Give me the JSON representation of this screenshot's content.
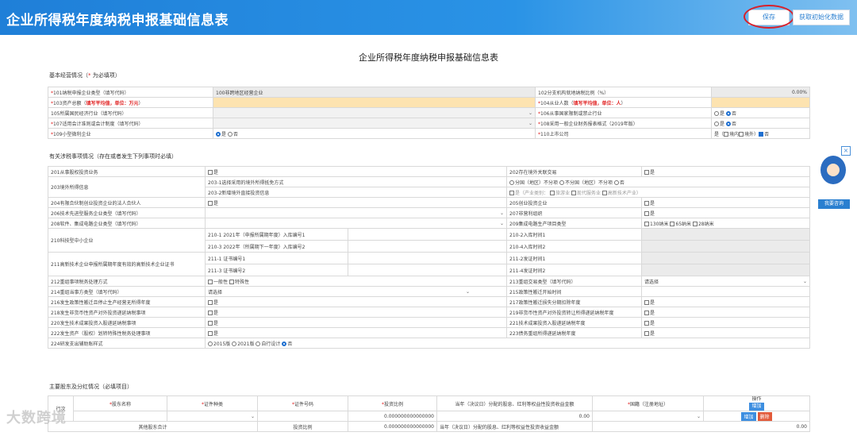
{
  "header": {
    "title": "企业所得税年度纳税申报基础信息表",
    "save_label": "保存",
    "fetch_label": "获取初始化数据"
  },
  "page_title": "企业所得税年度纳税申报基础信息表",
  "basic": {
    "heading": "基本经营情况（",
    "heading_star": "*",
    "heading_tail": " 为必填项）",
    "r101": "101纳税申报企业类型（填写代码）",
    "v101": "100非跨地区经营企业",
    "r102": "102分支机构就地纳税比例（%）",
    "v102": "0.00%",
    "r103a": "103资产总额（",
    "r103b": "填写平均值，单位：万元",
    "r103c": "）",
    "r104a": "104从业人数（",
    "r104b": "填写平均值，单位：人",
    "r104c": "）",
    "r105": "105所属国民经济行业（填写代码）",
    "r106": "106从事国家限制或禁止行业",
    "yes": "是",
    "no": "否",
    "r107": "107适用会计准则或会计制度（填写代码）",
    "r108": "108采用一般企业财务报表格式（2019年版）",
    "r109": "109小型微利企业",
    "r110": "110上市公司",
    "r110_v": "是（",
    "inner": "境内",
    "outer": "境外",
    "paren": "）"
  },
  "tax": {
    "heading": "有关涉税事项情况（存在或者发生下列事项时必填）",
    "r201": "201从事股权投资业务",
    "r202": "202存在境外关联交易",
    "r203": "203境外所得信息",
    "r203_1": "203-1选择采用的境外所得抵免方式",
    "r203_1v": "分国（地区）不分项",
    "r203_1v2": "不分国（地区）不分项",
    "r203_2": "203-2新增境外直接投资信息",
    "r203_2v": "是（产业类别：",
    "r203_2a": "旅游业",
    "r203_2b": "现代服务业",
    "r203_2c": "高新技术产业）",
    "r204": "204有限合伙制创业投资企业的法人合伙人",
    "r205": "205创业投资企业",
    "r206": "206技术先进型服务企业类型（填写代码）",
    "r207": "207非营利组织",
    "r208": "208软件、集成电路企业类型（填写代码）",
    "r209": "209集成电路生产项目类型",
    "r209a": "130纳米",
    "r209b": "65纳米",
    "r209c": "28纳米",
    "r210": "210科技型中小企业",
    "r210_1": "210-1  2021年（申报所属期年度）入库编号1",
    "r210_2": "210-2入库时间1",
    "r210_3": "210-3  2022年（所属期下一年度）入库编号2",
    "r210_4": "210-4入库时间2",
    "r211": "211高新技术企业申报所属期年度有效的高新技术企业证书",
    "r211_1": "211-1 证书编号1",
    "r211_2": "211-2发证时间1",
    "r211_3": "211-3 证书编号2",
    "r211_4": "211-4发证时间2",
    "r212": "212重组事项税务处理方式",
    "r212a": "一般性",
    "r212b": "特殊性",
    "r213": "213重组交易类型（填写代码）",
    "r213v": "请选择",
    "r214": "214重组当事方类型（填写代码）",
    "r214v": "请选择",
    "r215": "215政策性搬迁开始时间",
    "r216": "216发生政策性搬迁且停止生产经营无所得年度",
    "r217": "217政策性搬迁损失分期扣除年度",
    "r218": "218发生非货币性资产对外投资递延纳税事项",
    "r219": "219非货币性资产对外投资转让所得递延纳税年度",
    "r220": "220发生技术成果投资入股递延纳税事项",
    "r221": "221技术成果投资入股递延纳税年度",
    "r222": "222发生资产（股权）划转特殊性税务处理事项",
    "r223": "223债务重组所得递延纳税年度",
    "r224": "224研发支出辅助账样式",
    "r224a": "2015版",
    "r224b": "2021版",
    "r224c": "自行设计",
    "r224d": "否"
  },
  "share": {
    "heading": "主要股东及分红情况（必填项目）",
    "cols": [
      "行次",
      "股东名称",
      "证件种类",
      "证件号码",
      "投资比例",
      "当年（决议日）分配的股息、红利等权益性投资收益金额",
      "国籍（注册地址）",
      "操作"
    ],
    "add": "增加",
    "del": "删除",
    "row_ratio": "0.000000000000000",
    "row_amount": "0.00",
    "foot": "其他股东合计",
    "foot_ratio": "0.000000000000000",
    "foot_amount": "0.00"
  },
  "side": {
    "label": "我要咨询"
  },
  "watermark": "大数跨境"
}
